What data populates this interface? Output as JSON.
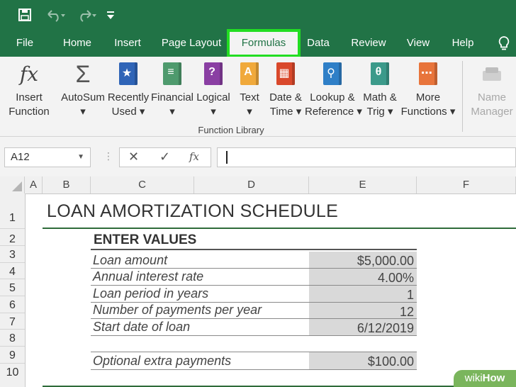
{
  "ribbon": {
    "tabs": [
      {
        "label": "File",
        "active": false
      },
      {
        "label": "Home",
        "active": false
      },
      {
        "label": "Insert",
        "active": false
      },
      {
        "label": "Page Layout",
        "active": false
      },
      {
        "label": "Formulas",
        "active": true
      },
      {
        "label": "Data",
        "active": false
      },
      {
        "label": "Review",
        "active": false
      },
      {
        "label": "View",
        "active": false
      },
      {
        "label": "Help",
        "active": false
      }
    ],
    "buttons": [
      {
        "line1": "Insert",
        "line2": "Function"
      },
      {
        "line1": "AutoSum",
        "line2": "▾"
      },
      {
        "line1": "Recently",
        "line2": "Used ▾"
      },
      {
        "line1": "Financial",
        "line2": "▾"
      },
      {
        "line1": "Logical",
        "line2": "▾"
      },
      {
        "line1": "Text",
        "line2": "▾"
      },
      {
        "line1": "Date &",
        "line2": "Time ▾"
      },
      {
        "line1": "Lookup &",
        "line2": "Reference ▾"
      },
      {
        "line1": "Math &",
        "line2": "Trig ▾"
      },
      {
        "line1": "More",
        "line2": "Functions ▾"
      },
      {
        "line1": "Name",
        "line2": "Manager"
      }
    ],
    "group_label": "Function Library"
  },
  "formula_bar": {
    "name_box": "A12",
    "formula": ""
  },
  "grid": {
    "columns": [
      "A",
      "B",
      "C",
      "D",
      "E",
      "F"
    ],
    "rows": [
      "1",
      "2",
      "3",
      "4",
      "5",
      "6",
      "7",
      "8",
      "9",
      "10"
    ],
    "title": "LOAN AMORTIZATION SCHEDULE",
    "section_header": "ENTER VALUES",
    "inputs": [
      {
        "label": "Loan amount",
        "value": "$5,000.00"
      },
      {
        "label": "Annual interest rate",
        "value": "4.00%"
      },
      {
        "label": "Loan period in years",
        "value": "1"
      },
      {
        "label": "Number of payments per year",
        "value": "12"
      },
      {
        "label": "Start date of loan",
        "value": "6/12/2019"
      }
    ],
    "extra": {
      "label": "Optional extra payments",
      "value": "$100.00"
    }
  },
  "colors": {
    "excel_green": "#217346",
    "highlight": "#22dd22",
    "input_fill": "#d9d9d9"
  },
  "watermark": {
    "prefix": "wiki",
    "suffix": "How"
  }
}
